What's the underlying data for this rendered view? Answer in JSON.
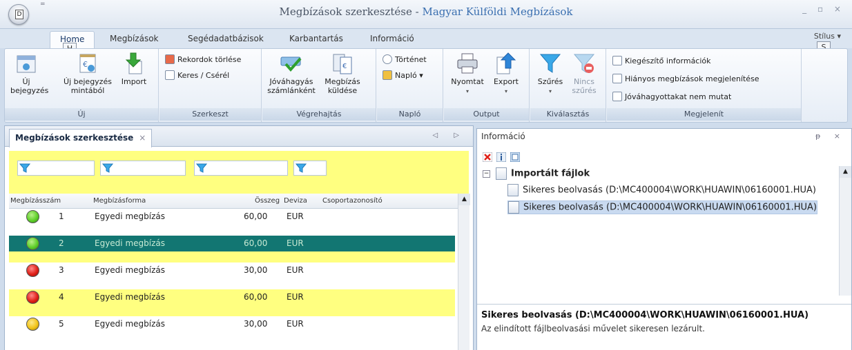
{
  "window": {
    "title": "Megbízások szerkesztése",
    "separator": " - ",
    "app_name": "Magyar Külföldi Megbízások",
    "controls": "_ ▫ ×",
    "orb_key": "D",
    "qat": "="
  },
  "tabs": [
    {
      "label": "Home",
      "key": "H"
    },
    {
      "label": "Megbízások"
    },
    {
      "label": "Segédadatbázisok"
    },
    {
      "label": "Karbantartás"
    },
    {
      "label": "Információ"
    }
  ],
  "style_menu": {
    "label": "Stílus",
    "key": "S",
    "arrow": "▾"
  },
  "ribbon": {
    "group_uj": {
      "label": "Új",
      "new_entry": [
        "Új",
        "bejegyzés"
      ],
      "new_from_template": [
        "Új bejegyzés",
        "mintából"
      ],
      "import": "Import"
    },
    "group_szerkeszt": {
      "label": "Szerkeszt",
      "delete_records": "Rekordok törlése",
      "find_replace": "Keres / Csérél"
    },
    "group_vegrehajtas": {
      "label": "Végrehajtás",
      "approve": [
        "Jóváhagyás",
        "számlánként"
      ],
      "send": [
        "Megbízás",
        "küldése"
      ]
    },
    "group_naplo": {
      "label": "Napló",
      "history": "Történet",
      "log": "Napló ▾"
    },
    "group_output": {
      "label": "Output",
      "print": "Nyomtat",
      "export": "Export",
      "arrow": "▾"
    },
    "group_kivalasztas": {
      "label": "Kiválasztás",
      "filter": "Szűrés",
      "no_filter": [
        "Nincs",
        "szűrés"
      ],
      "arrow": "▾"
    },
    "group_megjelenit": {
      "label": "Megjelenít",
      "opt1": "Kiegészítő információk",
      "opt2": "Hiányos megbízások megjelenítése",
      "opt3": "Jóváhagyottakat nem mutat"
    }
  },
  "doc": {
    "tab": "Megbízások szerkesztése",
    "tab_close": "×",
    "nav": "◁ ▷",
    "headers": {
      "number": "Megbízásszám",
      "form": "Megbízásforma",
      "amount": "Összeg",
      "currency": "Deviza",
      "group_id": "Csoportazonosító"
    },
    "rows": [
      {
        "status": "green",
        "number": "1",
        "form": "Egyedi megbízás",
        "amount": "60,00",
        "currency": "EUR"
      },
      {
        "status": "green",
        "number": "2",
        "form": "Egyedi megbízás",
        "amount": "60,00",
        "currency": "EUR"
      },
      {
        "status": "red",
        "number": "3",
        "form": "Egyedi megbízás",
        "amount": "30,00",
        "currency": "EUR"
      },
      {
        "status": "red",
        "number": "4",
        "form": "Egyedi megbízás",
        "amount": "60,00",
        "currency": "EUR"
      },
      {
        "status": "yellow",
        "number": "5",
        "form": "Egyedi megbízás",
        "amount": "30,00",
        "currency": "EUR"
      }
    ]
  },
  "info": {
    "title": "Információ",
    "controls": "ᵽ ×",
    "root": "Importált fájlok",
    "items": [
      "Sikeres beolvasás (D:\\MC400004\\WORK\\HUAWIN\\06160001.HUA)",
      "Sikeres beolvasás (D:\\MC400004\\WORK\\HUAWIN\\06160001.HUA)"
    ],
    "detail_title": "Sikeres beolvasás (D:\\MC400004\\WORK\\HUAWIN\\06160001.HUA)",
    "detail_body": "Az elindított fájlbeolvasási művelet sikeresen lezárult."
  },
  "colors": {
    "selected_row": "#127672",
    "highlight": "#ffff80",
    "green": "#5fcf2a",
    "red": "#e02018",
    "yellow": "#f2c418"
  }
}
